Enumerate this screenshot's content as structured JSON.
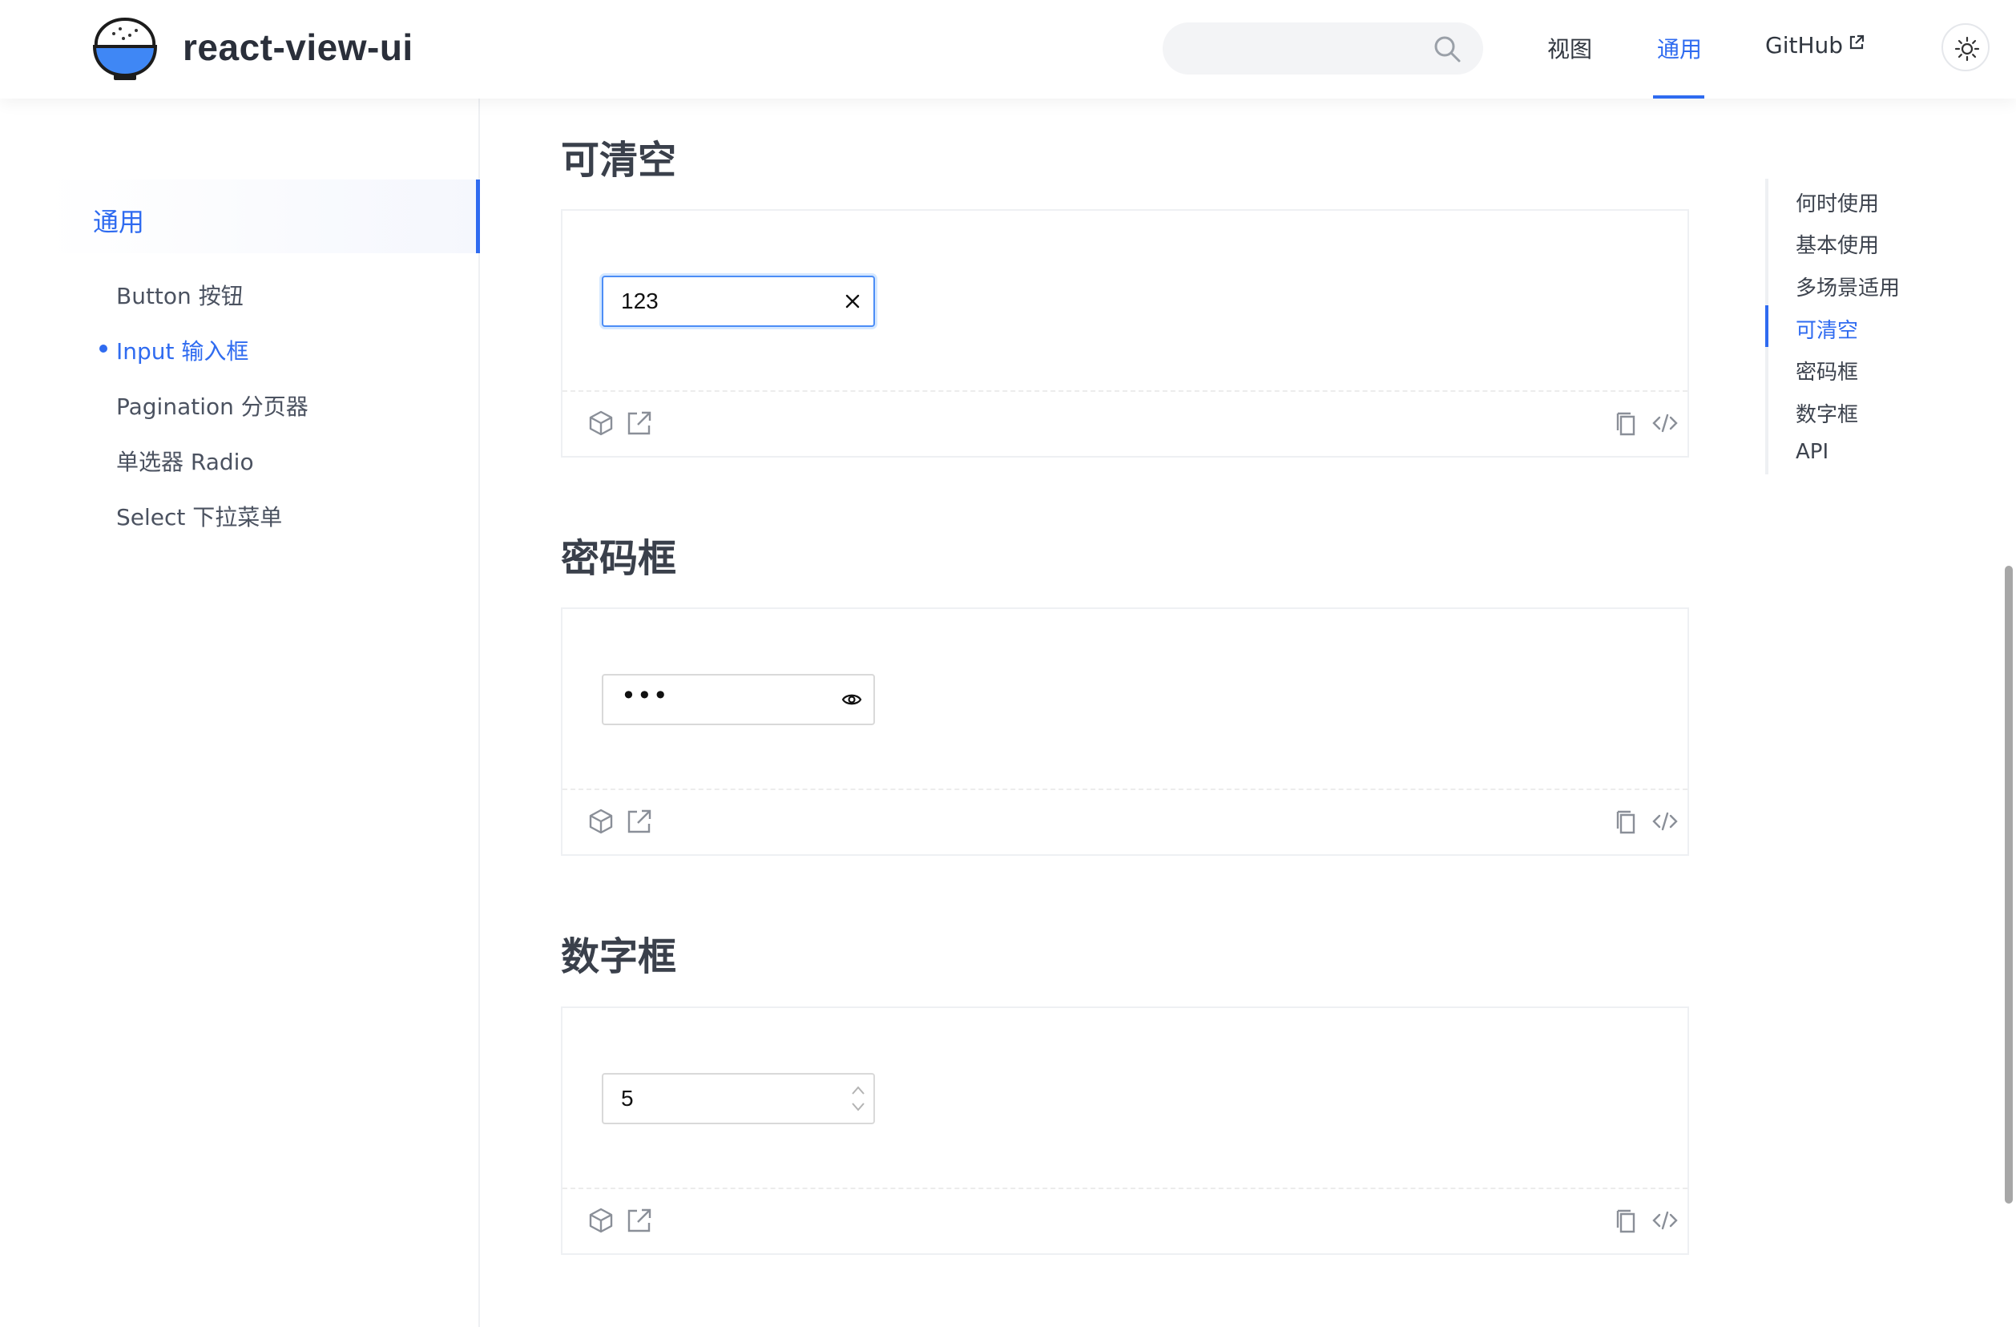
{
  "header": {
    "brand": "react-view-ui",
    "search_placeholder": "",
    "nav": [
      {
        "label": "视图"
      },
      {
        "label": "通用"
      },
      {
        "label": "GitHub"
      }
    ]
  },
  "sidebar": {
    "group": "通用",
    "items": [
      {
        "label": "Button 按钮"
      },
      {
        "label": "Input 输入框"
      },
      {
        "label": "Pagination 分页器"
      },
      {
        "label": "单选器 Radio"
      },
      {
        "label": "Select 下拉菜单"
      }
    ]
  },
  "sections": [
    {
      "title": "可清空",
      "input_value": "123"
    },
    {
      "title": "密码框",
      "input_value": "•••"
    },
    {
      "title": "数字框",
      "input_value": "5"
    }
  ],
  "toc": [
    {
      "label": "何时使用"
    },
    {
      "label": "基本使用"
    },
    {
      "label": "多场景适用"
    },
    {
      "label": "可清空"
    },
    {
      "label": "密码框"
    },
    {
      "label": "数字框"
    },
    {
      "label": "API"
    }
  ],
  "colors": {
    "accent": "#2f6bf0",
    "text": "#30363f",
    "border": "#eef0f3"
  }
}
